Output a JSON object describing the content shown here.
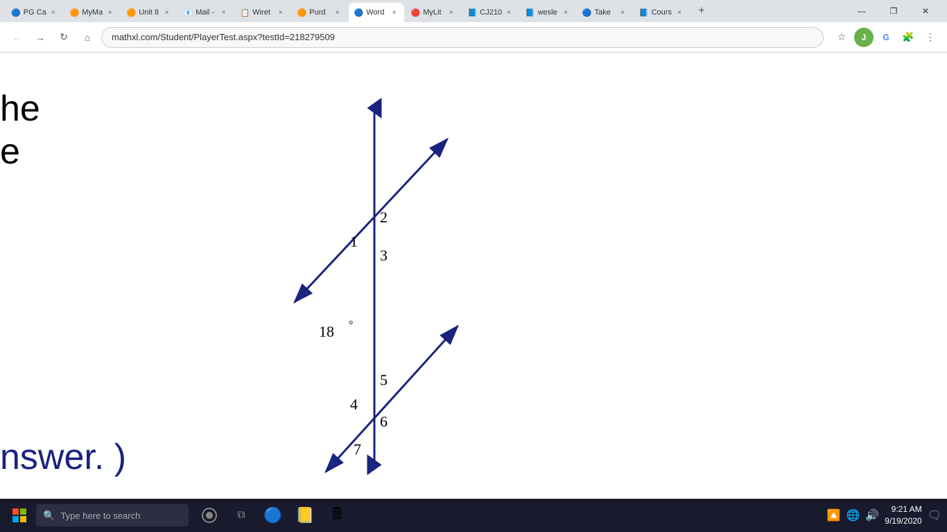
{
  "browser": {
    "tabs": [
      {
        "label": "PG Ca",
        "favicon": "🔵",
        "active": false,
        "close": "×"
      },
      {
        "label": "MyMa",
        "favicon": "🟠",
        "active": false,
        "close": "×"
      },
      {
        "label": "Unit 8",
        "favicon": "🟠",
        "active": false,
        "close": "×"
      },
      {
        "label": "Mail -",
        "favicon": "📧",
        "active": false,
        "close": "×"
      },
      {
        "label": "Wiret",
        "favicon": "📋",
        "active": false,
        "close": "×"
      },
      {
        "label": "Purd",
        "favicon": "🟠",
        "active": false,
        "close": "×"
      },
      {
        "label": "Word",
        "favicon": "🔵",
        "active": true,
        "close": "×"
      },
      {
        "label": "MyLit",
        "favicon": "🔴",
        "active": false,
        "close": "×"
      },
      {
        "label": "CJ210",
        "favicon": "📘",
        "active": false,
        "close": "×"
      },
      {
        "label": "wesle",
        "favicon": "📘",
        "active": false,
        "close": "×"
      },
      {
        "label": "Take",
        "favicon": "🔵",
        "active": false,
        "close": "×"
      },
      {
        "label": "Cours",
        "favicon": "📘",
        "active": false,
        "close": "×"
      }
    ],
    "address": "mathxl.com/Student/PlayerTest.aspx?testId=218279509",
    "window_controls": [
      "—",
      "❐",
      "✕"
    ]
  },
  "page": {
    "partial_text_top_line1": "he",
    "partial_text_top_line2": "e",
    "partial_text_bottom": "nswer. )",
    "diagram": {
      "labels": [
        "1",
        "2",
        "3",
        "4",
        "5",
        "6",
        "7",
        "18°"
      ]
    }
  },
  "taskbar": {
    "search_placeholder": "Type here to search",
    "time": "9:21 AM",
    "date": "9/19/2020"
  }
}
